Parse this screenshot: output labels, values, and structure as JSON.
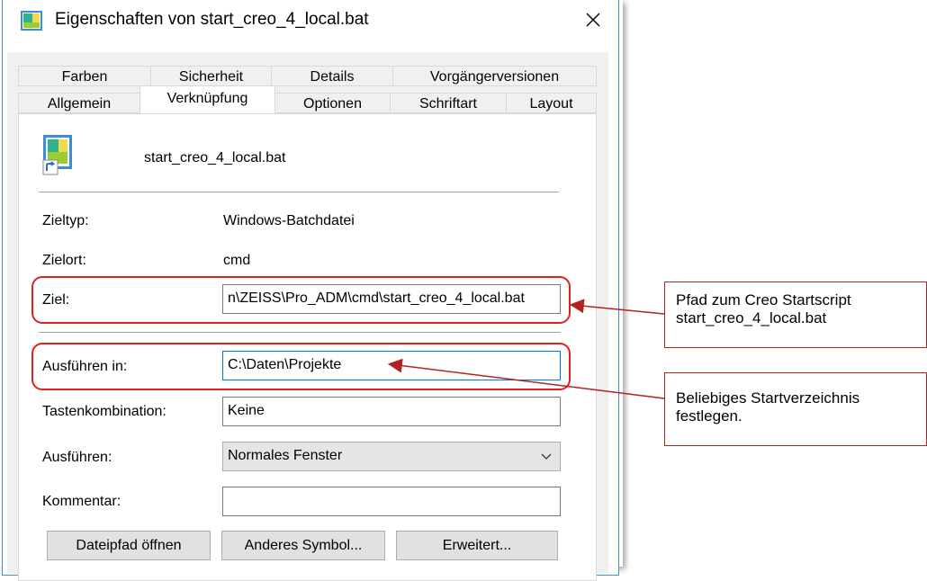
{
  "window": {
    "title": "Eigenschaften von start_creo_4_local.bat"
  },
  "tabs": {
    "row1": [
      "Farben",
      "Sicherheit",
      "Details",
      "Vorgängerversionen"
    ],
    "row2": [
      "Allgemein",
      "Verknüpfung",
      "Optionen",
      "Schriftart",
      "Layout"
    ],
    "active": "Verknüpfung"
  },
  "shortcut": {
    "filename": "start_creo_4_local.bat",
    "zieltyp_label": "Zieltyp:",
    "zieltyp_value": "Windows-Batchdatei",
    "zielort_label": "Zielort:",
    "zielort_value": "cmd",
    "ziel_label": "Ziel:",
    "ziel_value": "n\\ZEISS\\Pro_ADM\\cmd\\start_creo_4_local.bat",
    "ausfuehren_in_label": "Ausführen in:",
    "ausfuehren_in_value": "C:\\Daten\\Projekte",
    "tastenkombination_label": "Tastenkombination:",
    "tastenkombination_value": "Keine",
    "ausfuehren_label": "Ausführen:",
    "ausfuehren_value": "Normales Fenster",
    "kommentar_label": "Kommentar:",
    "kommentar_value": ""
  },
  "buttons": {
    "dateipfad": "Dateipfad öffnen",
    "anderes_symbol": "Anderes Symbol...",
    "erweitert": "Erweitert..."
  },
  "annotations": {
    "note1_line1": "Pfad zum Creo Startscript",
    "note1_line2": "start_creo_4_local.bat",
    "note2_line1": "Beliebiges Startverzeichnis",
    "note2_line2": "festlegen."
  },
  "colors": {
    "highlight": "#e02020",
    "arrow": "#b22222",
    "focus_border": "#0078d7"
  }
}
